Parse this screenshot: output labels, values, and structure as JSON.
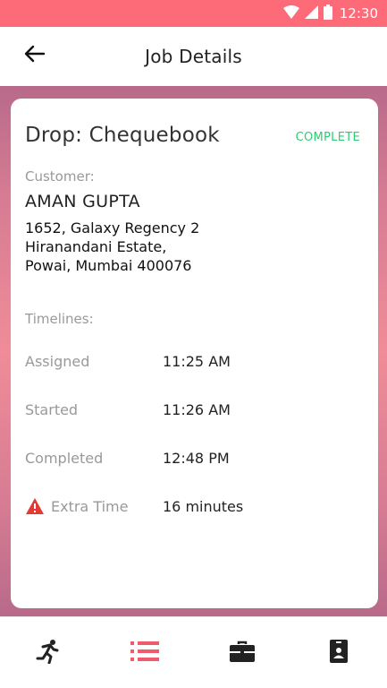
{
  "status_bar": {
    "time": "12:30",
    "icons": [
      "wifi-icon",
      "signal-icon",
      "battery-icon"
    ]
  },
  "header": {
    "title": "Job Details",
    "back_icon": "arrow-left-icon"
  },
  "job": {
    "title": "Drop: Chequebook",
    "status": "COMPLETE",
    "status_color": "#2ecc71",
    "customer_label": "Customer:",
    "customer_name": "AMAN GUPTA",
    "address_lines": [
      "1652, Galaxy Regency 2",
      "Hiranandani Estate,",
      "Powai, Mumbai 400076"
    ]
  },
  "timelines": {
    "label": "Timelines:",
    "rows": [
      {
        "label": "Assigned",
        "value": "11:25 AM"
      },
      {
        "label": "Started",
        "value": "11:26 AM"
      },
      {
        "label": "Completed",
        "value": "12:48 PM"
      },
      {
        "label": "Extra Time",
        "value": "16 minutes",
        "icon": "warning-icon"
      }
    ]
  },
  "bottom_nav": {
    "items": [
      {
        "name": "running-icon",
        "active": false
      },
      {
        "name": "list-icon",
        "active": true
      },
      {
        "name": "briefcase-icon",
        "active": false
      },
      {
        "name": "id-badge-icon",
        "active": false
      }
    ],
    "active_color": "#f05a6e",
    "inactive_color": "#222222"
  },
  "colors": {
    "status_bar": "#fe6b78",
    "warning": "#e53935"
  }
}
